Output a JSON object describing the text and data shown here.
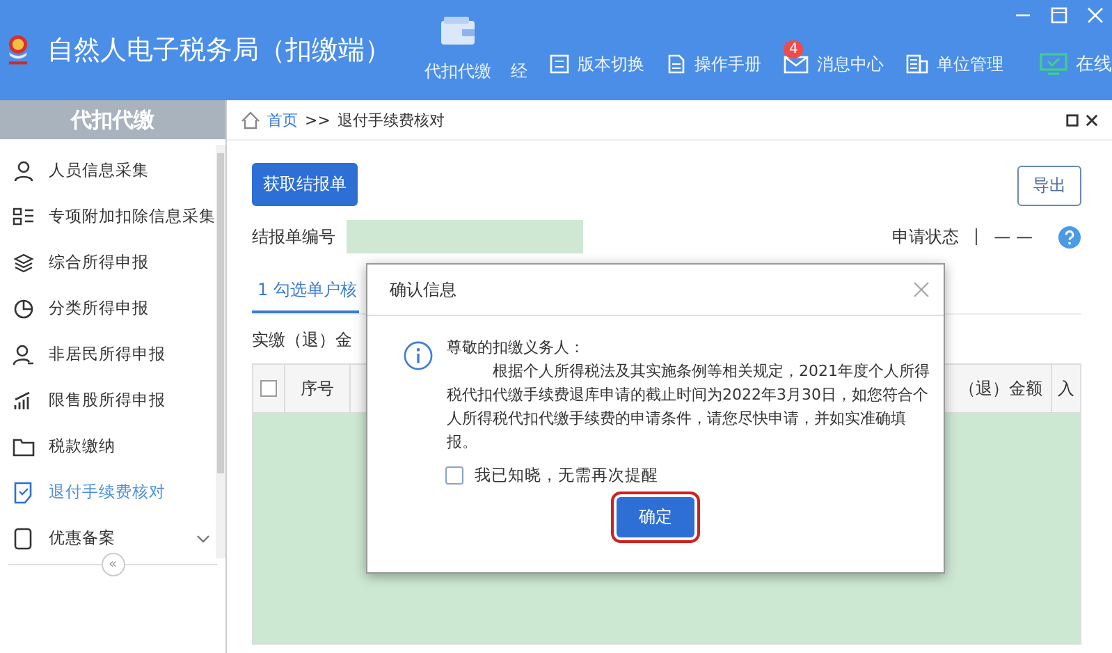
{
  "header": {
    "title": "自然人电子税务局（扣缴端）",
    "modules": [
      {
        "label": "代扣代缴"
      },
      {
        "label": "经"
      }
    ],
    "tools": [
      {
        "label": "版本切换"
      },
      {
        "label": "操作手册"
      },
      {
        "label": "消息中心",
        "badge": "4"
      },
      {
        "label": "单位管理"
      }
    ],
    "online": "在线"
  },
  "sidebar": {
    "title": "代扣代缴",
    "items": [
      {
        "label": "人员信息采集",
        "selected": false
      },
      {
        "label": "专项附加扣除信息采集",
        "selected": false
      },
      {
        "label": "综合所得申报",
        "selected": false
      },
      {
        "label": "分类所得申报",
        "selected": false
      },
      {
        "label": "非居民所得申报",
        "selected": false
      },
      {
        "label": "限售股所得申报",
        "selected": false
      },
      {
        "label": "税款缴纳",
        "selected": false
      },
      {
        "label": "退付手续费核对",
        "selected": true
      },
      {
        "label": "优惠备案",
        "selected": false,
        "expanded": false
      }
    ],
    "collapse": "«"
  },
  "breadcrumb": {
    "home": "首页",
    "separator": ">>",
    "current": "退付手续费核对"
  },
  "toolbar": {
    "fetch_button": "获取结报单",
    "export_button": "导出"
  },
  "form": {
    "report_label": "结报单编号",
    "status_label": "申请状态",
    "status_value": "— —"
  },
  "steps": [
    {
      "label": "1 勾选单户核",
      "selected": true
    }
  ],
  "amount_label": "实缴（退）金",
  "table": {
    "select_all_checked": false,
    "columns": [
      "序号",
      "",
      "（退）金额",
      "入"
    ]
  },
  "dialog": {
    "title": "确认信息",
    "greeting": "尊敬的扣缴义务人：",
    "body": "根据个人所得税法及其实施条例等相关规定，2021年度个人所得税代扣代缴手续费退库申请的截止时间为2022年3月30日，如您符合个人所得税代扣代缴手续费的申请条件，请您尽快申请，并如实准确填报。",
    "checkbox": {
      "label": "我已知晓，无需再次提醒",
      "checked": false
    },
    "confirm": "确定"
  }
}
